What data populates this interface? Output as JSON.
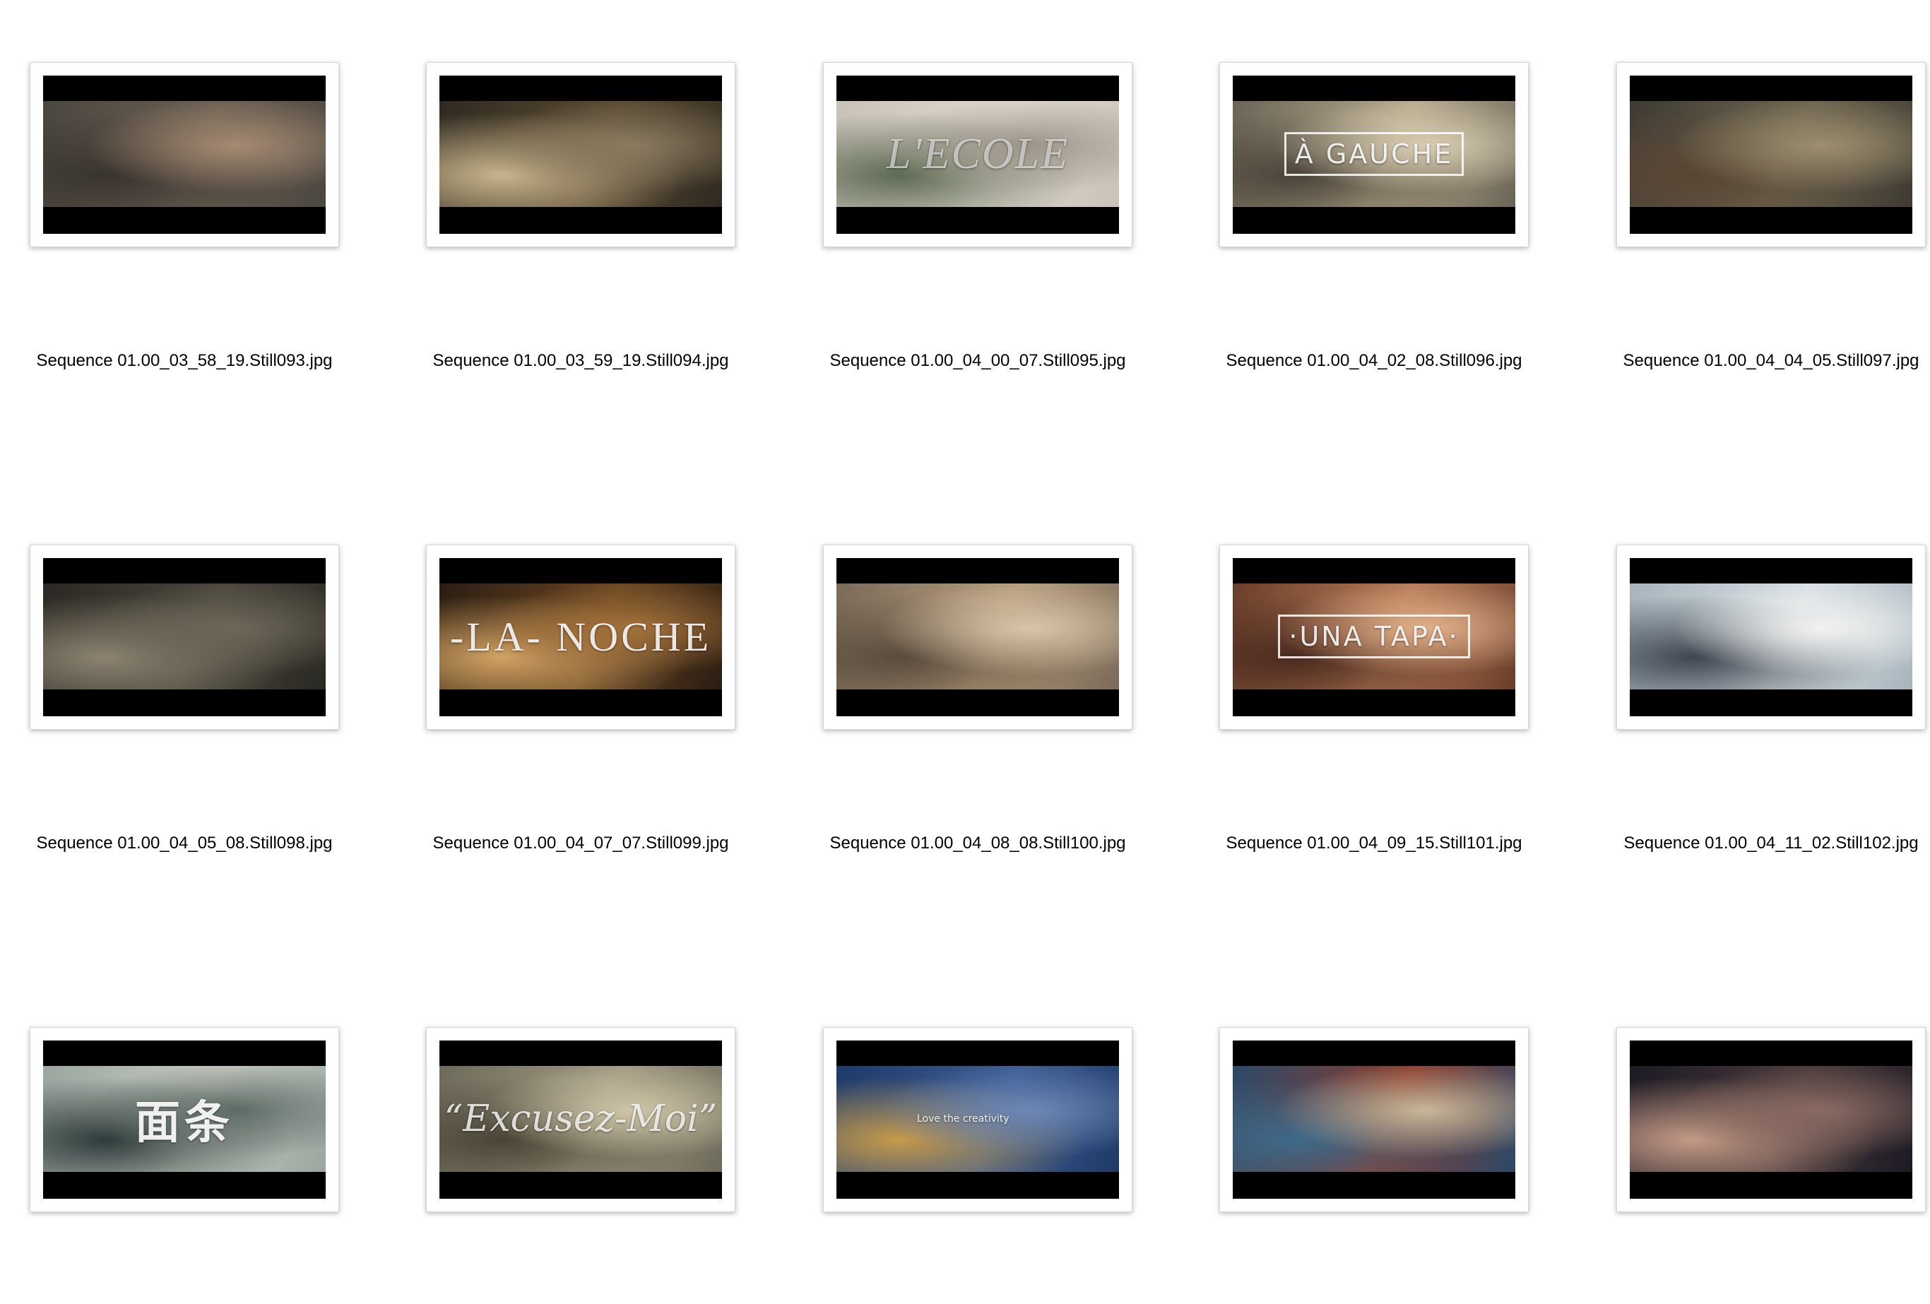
{
  "window": {
    "view": "icon-view"
  },
  "files": [
    {
      "name": "Sequence 01.00_03_58_19.Still093.jpg",
      "overlay": "",
      "style": "plain",
      "palette": [
        "#4a4640",
        "#6c6052",
        "#a58a72",
        "#3a342f"
      ],
      "icon": "image-thumbnail-icon"
    },
    {
      "name": "Sequence 01.00_03_59_19.Still094.jpg",
      "overlay": "",
      "style": "plain",
      "palette": [
        "#2f2a20",
        "#5a4a32",
        "#8a7a60",
        "#c8b48c"
      ],
      "icon": "image-thumbnail-icon"
    },
    {
      "name": "Sequence 01.00_04_00_07.Still095.jpg",
      "overlay": "L'ECOLE",
      "style": "serif-italic",
      "palette": [
        "#c9c2b8",
        "#e0dad2",
        "#9c9488",
        "#5e6a52"
      ],
      "icon": "image-thumbnail-icon"
    },
    {
      "name": "Sequence 01.00_04_02_08.Still096.jpg",
      "overlay": "À GAUCHE",
      "style": "boxed",
      "palette": [
        "#6a6456",
        "#b8ab8e",
        "#d8cdb2",
        "#4a4338"
      ],
      "icon": "image-thumbnail-icon"
    },
    {
      "name": "Sequence 01.00_04_04_05.Still097.jpg",
      "overlay": "",
      "style": "plain",
      "palette": [
        "#3e3a32",
        "#6e6550",
        "#9d8e6e",
        "#5a4634"
      ],
      "icon": "image-thumbnail-icon"
    },
    {
      "name": "Sequence 01.00_04_05_08.Still098.jpg",
      "overlay": "",
      "style": "plain",
      "palette": [
        "#2a2823",
        "#4a463c",
        "#6d6758",
        "#8c8370"
      ],
      "icon": "image-thumbnail-icon"
    },
    {
      "name": "Sequence 01.00_04_07_07.Still099.jpg",
      "overlay": "-LA- NOCHE",
      "style": "serif-big",
      "palette": [
        "#2a1d12",
        "#6a4522",
        "#a2713a",
        "#d1a263"
      ],
      "icon": "image-thumbnail-icon"
    },
    {
      "name": "Sequence 01.00_04_08_08.Still100.jpg",
      "overlay": "",
      "style": "plain",
      "palette": [
        "#7a6a58",
        "#b79c7d",
        "#d8c4a8",
        "#5a4b3c"
      ],
      "icon": "image-thumbnail-icon"
    },
    {
      "name": "Sequence 01.00_04_09_15.Still101.jpg",
      "overlay": "·UNA TAPA·",
      "style": "boxed",
      "palette": [
        "#6a3e2a",
        "#b57a56",
        "#e0b08a",
        "#4a2a1e"
      ],
      "icon": "image-thumbnail-icon"
    },
    {
      "name": "Sequence 01.00_04_11_02.Still102.jpg",
      "overlay": "",
      "style": "plain",
      "palette": [
        "#a8b4bc",
        "#d8e0e4",
        "#f2f2f0",
        "#3e4650"
      ],
      "icon": "image-thumbnail-icon"
    },
    {
      "name": "",
      "overlay": "面条",
      "style": "cjk",
      "palette": [
        "#9aa6a0",
        "#c8ccc2",
        "#5d6a66",
        "#2e3a3a"
      ],
      "icon": "image-thumbnail-icon"
    },
    {
      "name": "",
      "overlay": "“Excusez-Moi”",
      "style": "script",
      "palette": [
        "#6e6a5a",
        "#a09a82",
        "#cfc6a8",
        "#4a4536"
      ],
      "icon": "image-thumbnail-icon"
    },
    {
      "name": "",
      "overlay": "Love the creativity",
      "style": "small",
      "palette": [
        "#1f3a68",
        "#3c5c92",
        "#6d87b5",
        "#c59a4a"
      ],
      "icon": "image-thumbnail-icon"
    },
    {
      "name": "",
      "overlay": "",
      "style": "plain",
      "palette": [
        "#2a4a6a",
        "#8c3a2a",
        "#c8b89a",
        "#3c6a8a"
      ],
      "icon": "image-thumbnail-icon"
    },
    {
      "name": "",
      "overlay": "",
      "style": "plain",
      "palette": [
        "#1c1a24",
        "#4a3a3c",
        "#8a6a62",
        "#c49a86"
      ],
      "icon": "image-thumbnail-icon"
    }
  ]
}
